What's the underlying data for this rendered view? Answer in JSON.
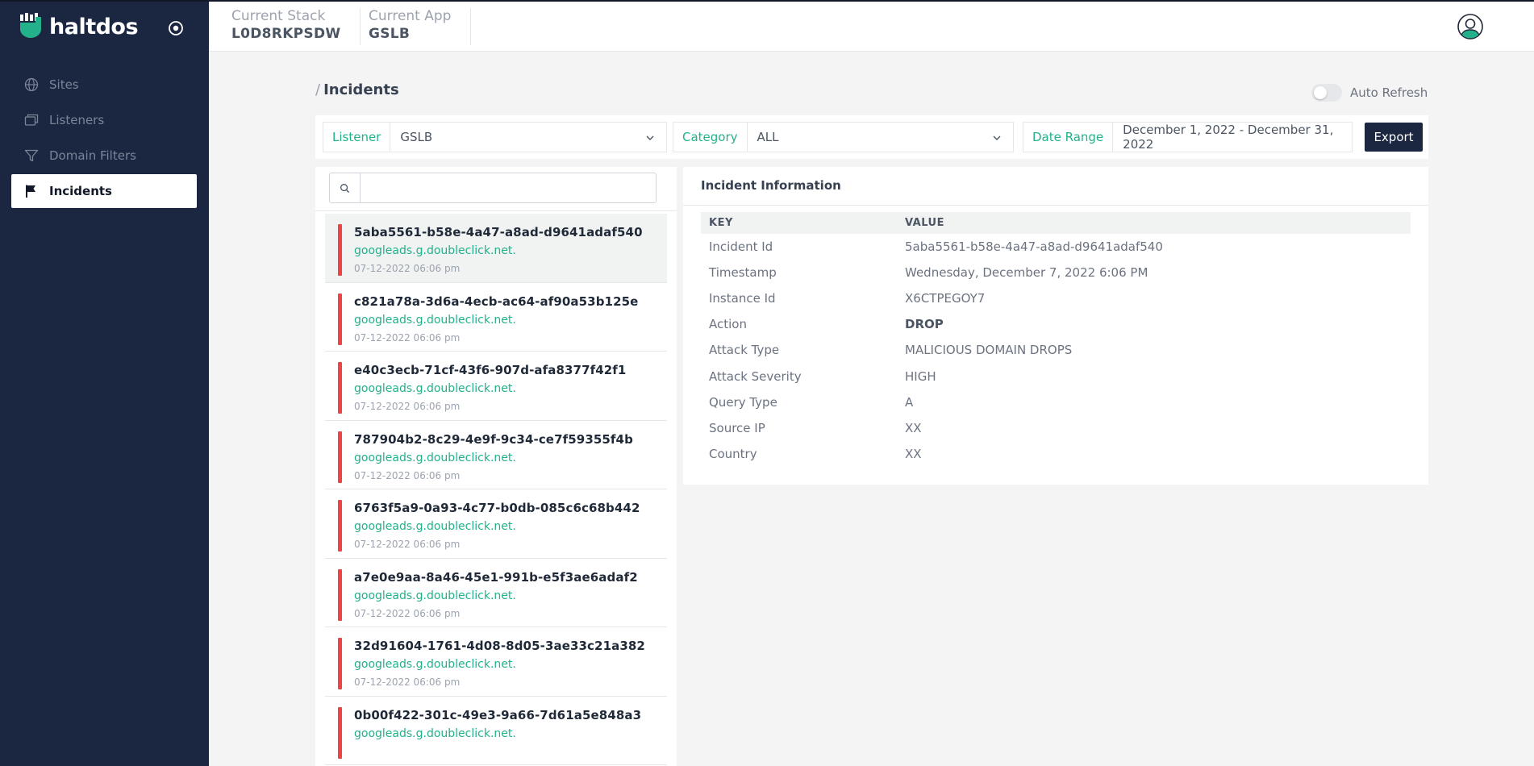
{
  "brand": {
    "name": "haltdos"
  },
  "sidebar": {
    "items": [
      {
        "label": "Sites",
        "icon": "globe-icon",
        "active": false
      },
      {
        "label": "Listeners",
        "icon": "windows-icon",
        "active": false
      },
      {
        "label": "Domain Filters",
        "icon": "filter-icon",
        "active": false
      },
      {
        "label": "Incidents",
        "icon": "flag-icon",
        "active": true
      }
    ]
  },
  "header": {
    "stack_label": "Current Stack",
    "stack_value": "L0D8RKPSDW",
    "app_label": "Current App",
    "app_value": "GSLB"
  },
  "page": {
    "slash": "/",
    "title": "Incidents",
    "auto_refresh_label": "Auto Refresh",
    "auto_refresh_on": false
  },
  "filters": {
    "listener_label": "Listener",
    "listener_value": "GSLB",
    "category_label": "Category",
    "category_value": "ALL",
    "date_label": "Date Range",
    "date_value": "December 1, 2022 - December 31, 2022",
    "export_label": "Export"
  },
  "search": {
    "placeholder": "",
    "value": ""
  },
  "incidents": [
    {
      "id": "5aba5561-b58e-4a47-a8ad-d9641adaf540",
      "domain": "googleads.g.doubleclick.net.",
      "time": "07-12-2022 06:06 pm"
    },
    {
      "id": "c821a78a-3d6a-4ecb-ac64-af90a53b125e",
      "domain": "googleads.g.doubleclick.net.",
      "time": "07-12-2022 06:06 pm"
    },
    {
      "id": "e40c3ecb-71cf-43f6-907d-afa8377f42f1",
      "domain": "googleads.g.doubleclick.net.",
      "time": "07-12-2022 06:06 pm"
    },
    {
      "id": "787904b2-8c29-4e9f-9c34-ce7f59355f4b",
      "domain": "googleads.g.doubleclick.net.",
      "time": "07-12-2022 06:06 pm"
    },
    {
      "id": "6763f5a9-0a93-4c77-b0db-085c6c68b442",
      "domain": "googleads.g.doubleclick.net.",
      "time": "07-12-2022 06:06 pm"
    },
    {
      "id": "a7e0e9aa-8a46-45e1-991b-e5f3ae6adaf2",
      "domain": "googleads.g.doubleclick.net.",
      "time": "07-12-2022 06:06 pm"
    },
    {
      "id": "32d91604-1761-4d08-8d05-3ae33c21a382",
      "domain": "googleads.g.doubleclick.net.",
      "time": "07-12-2022 06:06 pm"
    },
    {
      "id": "0b00f422-301c-49e3-9a66-7d61a5e848a3",
      "domain": "googleads.g.doubleclick.net.",
      "time": ""
    }
  ],
  "detail": {
    "title": "Incident Information",
    "key_header": "KEY",
    "value_header": "VALUE",
    "rows": [
      {
        "key": "Incident Id",
        "value": "5aba5561-b58e-4a47-a8ad-d9641adaf540",
        "strong": false
      },
      {
        "key": "Timestamp",
        "value": "Wednesday, December 7, 2022 6:06 PM",
        "strong": false
      },
      {
        "key": "Instance Id",
        "value": "X6CTPEGOY7",
        "strong": false
      },
      {
        "key": "Action",
        "value": "DROP",
        "strong": true
      },
      {
        "key": "Attack Type",
        "value": "MALICIOUS DOMAIN DROPS",
        "strong": false
      },
      {
        "key": "Attack Severity",
        "value": "HIGH",
        "strong": false
      },
      {
        "key": "Query Type",
        "value": "A",
        "strong": false
      },
      {
        "key": "Source IP",
        "value": "XX",
        "strong": false
      },
      {
        "key": "Country",
        "value": "XX",
        "strong": false
      }
    ]
  },
  "colors": {
    "sidebar_bg": "#1b2641",
    "accent_green": "#22b18b",
    "severity_red": "#ef4444"
  }
}
